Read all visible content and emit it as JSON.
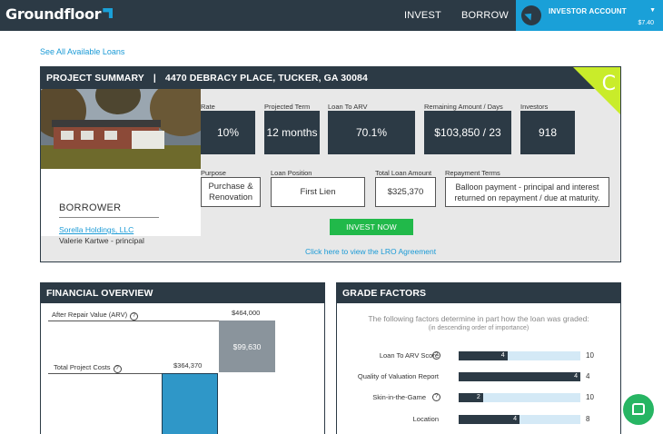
{
  "header": {
    "logo": "Groundfloor",
    "nav": [
      "INVEST",
      "BORROW"
    ],
    "account_label": "INVESTOR ACCOUNT",
    "balance": "$7.40"
  },
  "see_all_link": "See All Available Loans",
  "summary": {
    "title": "PROJECT SUMMARY",
    "separator": "|",
    "address": "4470 DEBRACY PLACE, TUCKER, GA 30084",
    "grade": "C",
    "stats": [
      {
        "label": "Rate",
        "value": "10%"
      },
      {
        "label": "Projected Term",
        "value": "12 months"
      },
      {
        "label": "Loan To ARV",
        "value": "70.1%"
      },
      {
        "label": "Remaining Amount / Days",
        "value": "$103,850 / 23"
      },
      {
        "label": "Investors",
        "value": "918"
      }
    ],
    "info": [
      {
        "label": "Purpose",
        "value": "Purchase & Renovation"
      },
      {
        "label": "Loan Position",
        "value": "First Lien"
      },
      {
        "label": "Total Loan Amount",
        "value": "$325,370"
      },
      {
        "label": "Repayment Terms",
        "value": "Balloon payment - principal and interest returned on repayment / due at maturity."
      }
    ],
    "borrower_heading": "BORROWER",
    "borrower_company": "Sorella Holdings, LLC",
    "borrower_person": "Valerie Kartwe - principal",
    "invest_button": "INVEST NOW",
    "lro_link": "Click here to view the LRO Agreement"
  },
  "financial": {
    "title": "FINANCIAL OVERVIEW",
    "arv_label": "After Repair Value (ARV)",
    "arv_value": "$464,000",
    "gap_value": "$99,630",
    "cost_label": "Total Project Costs",
    "cost_value": "$364,370",
    "help_glyph": "?"
  },
  "grade_factors": {
    "title": "GRADE FACTORS",
    "intro": "The following factors determine in part how the loan was graded:",
    "intro_sub": "(in descending order of importance)",
    "help_glyph": "?",
    "factors": [
      {
        "label": "Loan To ARV Score",
        "score": "4",
        "max": "10",
        "fraction": 0.4,
        "help": true
      },
      {
        "label": "Quality of Valuation Report",
        "score": "4",
        "max": "4",
        "fraction": 1.0,
        "help": false
      },
      {
        "label": "Skin-in-the-Game",
        "score": "2",
        "max": "10",
        "fraction": 0.2,
        "help": true
      },
      {
        "label": "Location",
        "score": "4",
        "max": "8",
        "fraction": 0.5,
        "help": false
      }
    ]
  }
}
